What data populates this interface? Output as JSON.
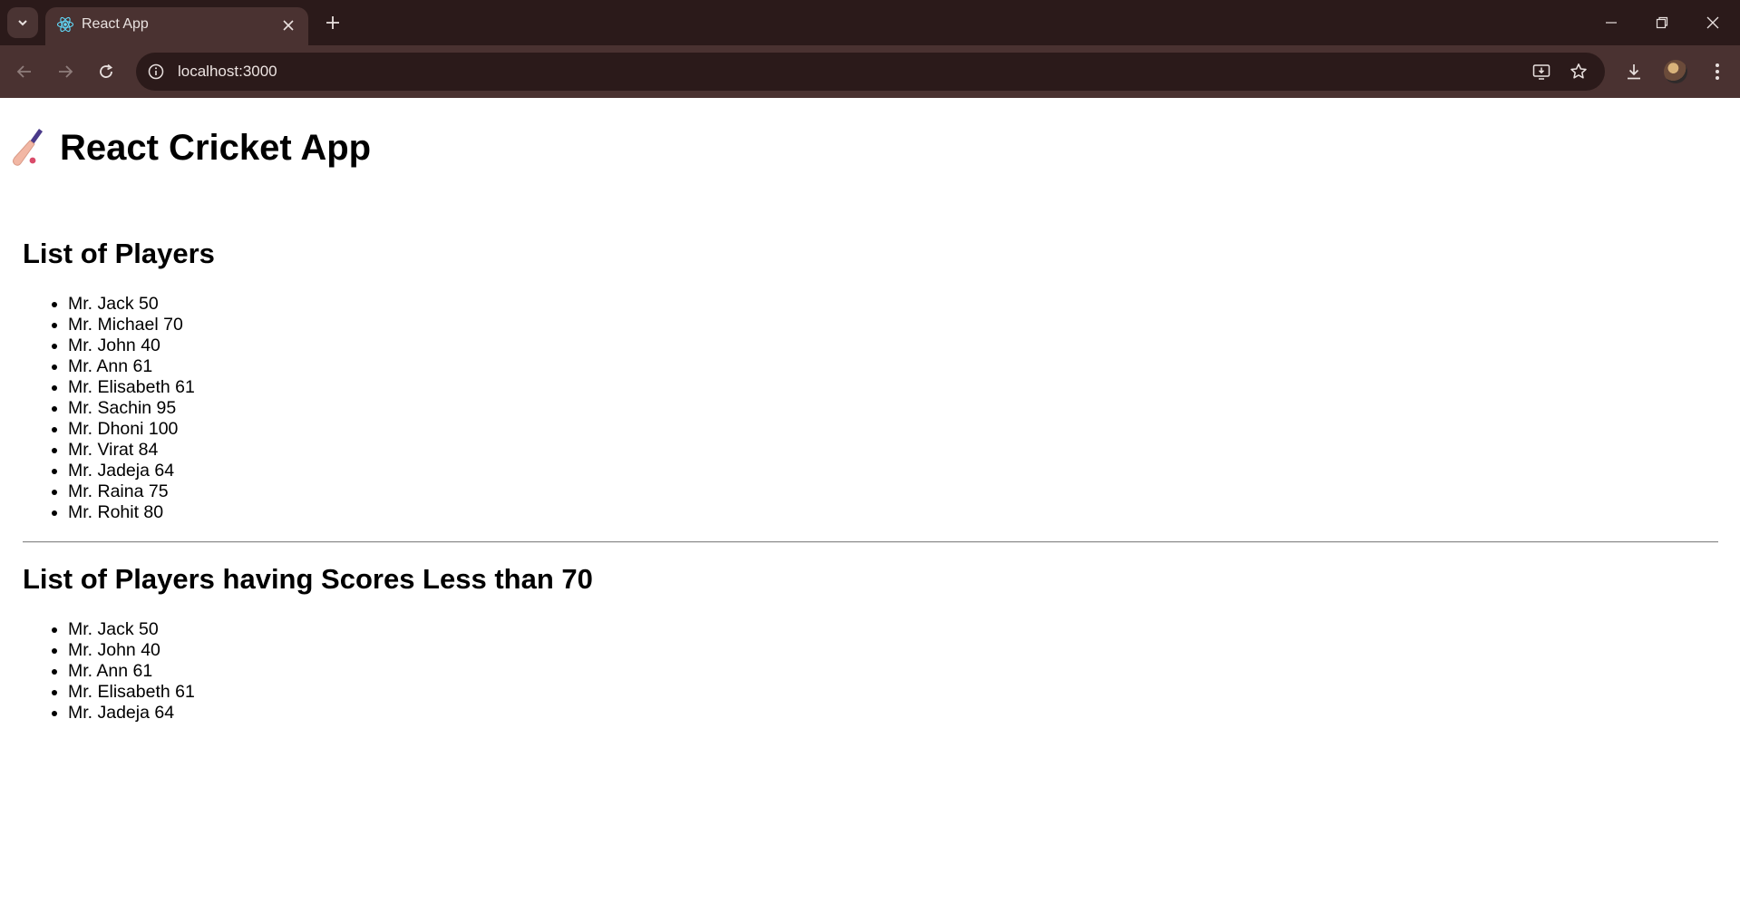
{
  "browser": {
    "tab_title": "React App",
    "url": "localhost:3000"
  },
  "app": {
    "title": "React Cricket App",
    "title_emoji": "cricket-bat-icon"
  },
  "all_players": {
    "heading": "List of Players",
    "items": [
      "Mr. Jack 50",
      "Mr. Michael 70",
      "Mr. John 40",
      "Mr. Ann 61",
      "Mr. Elisabeth 61",
      "Mr. Sachin 95",
      "Mr. Dhoni 100",
      "Mr. Virat 84",
      "Mr. Jadeja 64",
      "Mr. Raina 75",
      "Mr. Rohit 80"
    ]
  },
  "low_scorers": {
    "heading": "List of Players having Scores Less than 70",
    "items": [
      "Mr. Jack 50",
      "Mr. John 40",
      "Mr. Ann 61",
      "Mr. Elisabeth 61",
      "Mr. Jadeja 64"
    ]
  },
  "colors": {
    "chrome_dark": "#2b1a1a",
    "chrome_toolbar": "#4a3231",
    "page_bg": "#ffffff"
  }
}
